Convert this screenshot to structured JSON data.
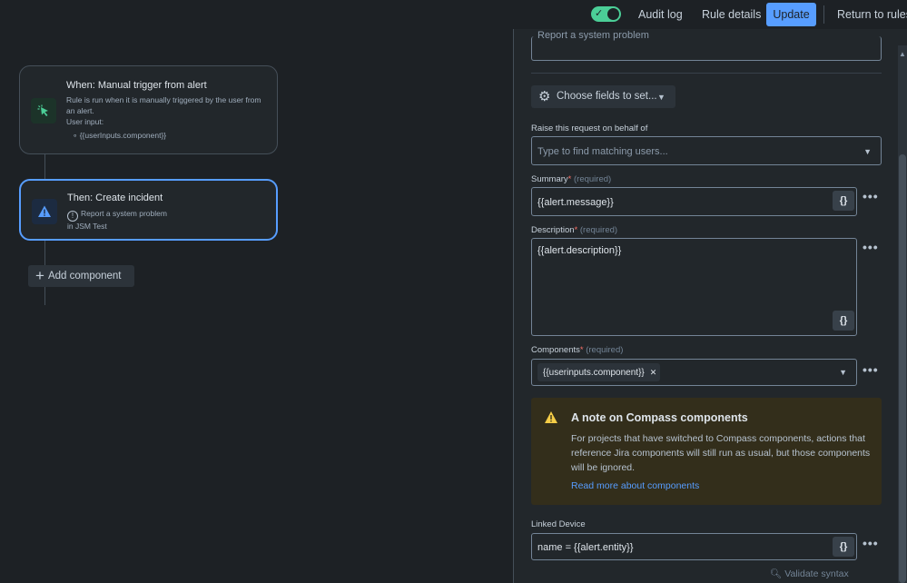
{
  "topbar": {
    "audit_log": "Audit log",
    "rule_details": "Rule details",
    "update": "Update",
    "return": "Return to rules"
  },
  "trigger": {
    "title": "When: Manual trigger from alert",
    "desc": "Rule is run when it is manually triggered by the user from an alert.",
    "user_input_label": "User input:",
    "bullet": "{{userInputs.component}}"
  },
  "action": {
    "title": "Then: Create incident",
    "sub_line1": "Report a system problem",
    "sub_line2": "in JSM Test"
  },
  "add_component": "Add component",
  "panel": {
    "request_type_value": "Report a system problem",
    "choose_fields": "Choose fields to set...",
    "behalf_label": "Raise this request on behalf of",
    "behalf_placeholder": "Type to find matching users...",
    "summary_label": "Summary",
    "summary_value": "{{alert.message}}",
    "description_label": "Description",
    "description_value": "{{alert.description}}",
    "components_label": "Components",
    "components_tag": "{{userinputs.component}}",
    "required": "(required)",
    "brace": "{}",
    "note_title": "A note on Compass components",
    "note_body": "For projects that have switched to Compass components, actions that reference Jira components will still run as usual, but those components will be ignored.",
    "note_link": "Read more about components",
    "linked_label": "Linked Device",
    "linked_value": "name = {{alert.entity}}",
    "validate": "Validate syntax"
  },
  "colors": {
    "background": "#1d2125",
    "panel": "#22272b",
    "accent": "#579dff",
    "toggle_on": "#4bce97",
    "warning": "#f5cd47",
    "required_star": "#f87168"
  }
}
